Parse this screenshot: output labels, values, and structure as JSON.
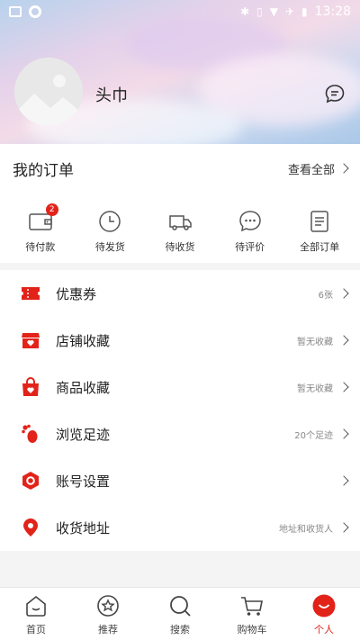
{
  "status": {
    "time": "13:28"
  },
  "profile": {
    "name": "头巾"
  },
  "orders": {
    "title": "我的订单",
    "view_all": "查看全部",
    "items": [
      {
        "label": "待付款",
        "badge": "2"
      },
      {
        "label": "待发货"
      },
      {
        "label": "待收货"
      },
      {
        "label": "待评价"
      },
      {
        "label": "全部订单"
      }
    ]
  },
  "menu": [
    {
      "label": "优惠券",
      "value": "6张"
    },
    {
      "label": "店铺收藏",
      "value": "暂无收藏"
    },
    {
      "label": "商品收藏",
      "value": "暂无收藏"
    },
    {
      "label": "浏览足迹",
      "value": "20个足迹"
    },
    {
      "label": "账号设置",
      "value": ""
    },
    {
      "label": "收货地址",
      "value": "地址和收货人"
    }
  ],
  "tabs": [
    {
      "label": "首页"
    },
    {
      "label": "推荐"
    },
    {
      "label": "搜索"
    },
    {
      "label": "购物车"
    },
    {
      "label": "个人"
    }
  ],
  "colors": {
    "accent": "#e2231a"
  }
}
